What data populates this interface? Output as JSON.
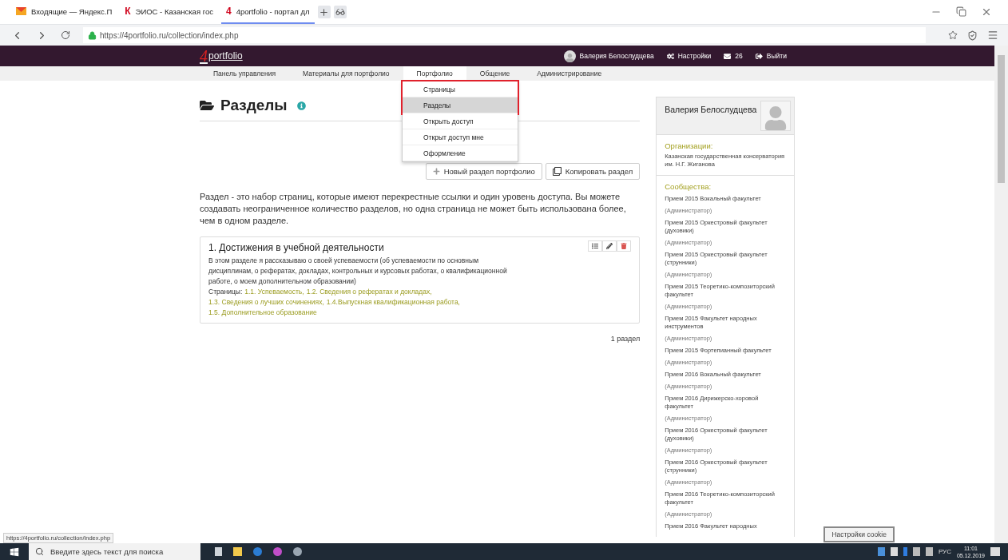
{
  "browser": {
    "tabs": [
      {
        "title": "Входящие — Яндекс.П",
        "kind": "mail",
        "selected": false
      },
      {
        "title": "ЭИОС - Казанская гос",
        "kind": "letter",
        "mark": "К",
        "selected": false
      },
      {
        "title": "4portfolio - портал дл",
        "kind": "letter",
        "mark": "4",
        "selected": true
      }
    ],
    "address": "https://4portfolio.ru/collection/index.php"
  },
  "header": {
    "logo": {
      "mark": "4",
      "text": "portfolio"
    },
    "user": "Валерия Белослудцева",
    "settings": "Настройки",
    "messages": "26",
    "logout": "Выйти"
  },
  "nav": [
    {
      "label": "Панель управления",
      "selected": false
    },
    {
      "label": "Материалы для портфолио",
      "selected": false
    },
    {
      "label": "Портфолио",
      "selected": true
    },
    {
      "label": "Общение",
      "selected": false
    },
    {
      "label": "Администрирование",
      "selected": false
    }
  ],
  "dropdown": [
    {
      "label": "Страницы",
      "selected": false,
      "highlighted": true
    },
    {
      "label": "Разделы",
      "selected": true,
      "highlighted": true
    },
    {
      "label": "Открыть доступ",
      "selected": false,
      "highlighted": false
    },
    {
      "label": "Открыт доступ мне",
      "selected": false,
      "highlighted": false
    },
    {
      "label": "Оформление",
      "selected": false,
      "highlighted": false
    }
  ],
  "page": {
    "title": "Разделы",
    "buttons": [
      {
        "kind": "new",
        "label": "Новый раздел портфолио"
      },
      {
        "kind": "copy",
        "label": "Копировать раздел"
      }
    ],
    "description": "Раздел - это набор страниц, которые имеют перекрестные ссылки и один уровень доступа. Вы можете создавать неограниченное количество разделов, но одна страница не может быть использована более, чем в одном разделе.",
    "collections": [
      {
        "title": "1. Достижения в учебной деятельности",
        "description": "В этом разделе я рассказываю о своей успеваемости (об успеваемости по основным дисциплинам, о рефератах, докладах, контрольных и курсовых работах, о квалификационной работе, о моем дополнительном образовании)",
        "pages_label": "Страницы:",
        "pages": [
          "1.1. Успеваемость,",
          "1.2. Сведения о рефератах и докладах,",
          "1.3. Сведения о лучших сочинениях,",
          "1.4.Выпускная квалификационная работа,",
          "1.5. Дополнительное образование"
        ]
      }
    ],
    "count": "1 раздел"
  },
  "sidebar": {
    "name": "Валерия Белослудцева",
    "organizations_label": "Организации:",
    "organization": "Казанская государственная консерватория им. Н.Г. Жиганова",
    "communities_label": "Сообщества:",
    "communities": [
      {
        "name": "Прием 2015 Вокальный факультет",
        "role": "(Администратор)"
      },
      {
        "name": "Прием 2015 Оркестровый факультет (духовики)",
        "role": "(Администратор)"
      },
      {
        "name": "Прием 2015 Оркестровый факультет (струнники)",
        "role": "(Администратор)"
      },
      {
        "name": "Прием 2015 Теоретико-композиторский факультет",
        "role": "(Администратор)"
      },
      {
        "name": "Прием 2015 Факультет народных инструментов",
        "role": "(Администратор)"
      },
      {
        "name": "Прием 2015 Фортепианный факультет",
        "role": "(Администратор)"
      },
      {
        "name": "Прием 2016 Вокальный факультет",
        "role": "(Администратор)"
      },
      {
        "name": "Прием 2016 Дирижерско-хоровой факультет",
        "role": "(Администратор)"
      },
      {
        "name": "Прием 2016 Оркестровый факультет (духовики)",
        "role": "(Администратор)"
      },
      {
        "name": "Прием 2016 Оркестровый факультет (струнники)",
        "role": "(Администратор)"
      },
      {
        "name": "Прием 2016 Теоретико-композиторский факультет",
        "role": "(Администратор)"
      },
      {
        "name": "Прием 2016 Факультет народных"
      }
    ]
  },
  "status_url": "https://4portfolio.ru/collection/index.php",
  "cookie_button": "Настройки cookie",
  "taskbar": {
    "search_placeholder": "Введите здесь текст для поиска",
    "language": "РУС",
    "time": "11:01",
    "date": "05.12.2019"
  }
}
